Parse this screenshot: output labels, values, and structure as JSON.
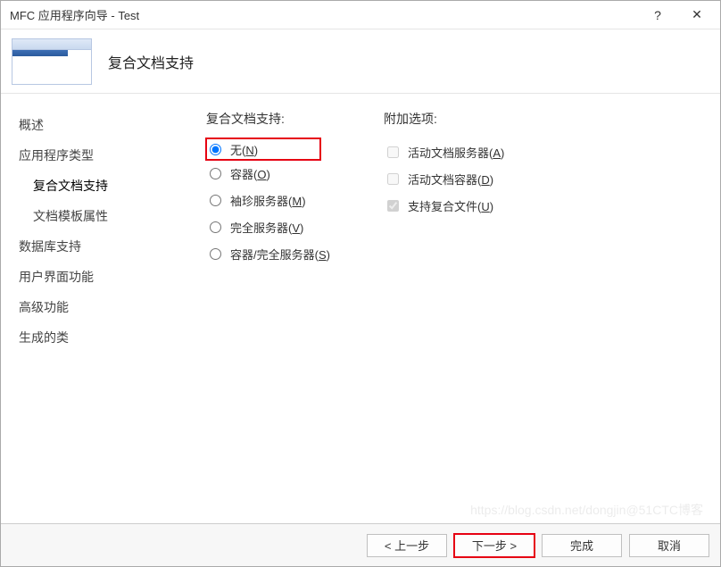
{
  "titlebar": {
    "title": "MFC 应用程序向导 - Test"
  },
  "header": {
    "heading": "复合文档支持"
  },
  "sidebar": {
    "items": [
      {
        "label": "概述",
        "sub": false
      },
      {
        "label": "应用程序类型",
        "sub": false
      },
      {
        "label": "复合文档支持",
        "sub": true,
        "active": true
      },
      {
        "label": "文档模板属性",
        "sub": true
      },
      {
        "label": "数据库支持",
        "sub": false
      },
      {
        "label": "用户界面功能",
        "sub": false
      },
      {
        "label": "高级功能",
        "sub": false
      },
      {
        "label": "生成的类",
        "sub": false
      }
    ]
  },
  "compound": {
    "label": "复合文档支持:",
    "options": {
      "none": {
        "text": "无",
        "accel": "N",
        "checked": true
      },
      "container": {
        "text": "容器",
        "accel": "O",
        "checked": false
      },
      "miniserver": {
        "text": "袖珍服务器",
        "accel": "M",
        "checked": false
      },
      "fullserver": {
        "text": "完全服务器",
        "accel": "V",
        "checked": false
      },
      "contserver": {
        "text": "容器/完全服务器",
        "accel": "S",
        "checked": false
      }
    }
  },
  "additional": {
    "label": "附加选项:",
    "options": {
      "activeserver": {
        "text": "活动文档服务器",
        "accel": "A",
        "checked": false
      },
      "activecontainer": {
        "text": "活动文档容器",
        "accel": "D",
        "checked": false
      },
      "compoundfile": {
        "text": "支持复合文件",
        "accel": "U",
        "checked": true
      }
    }
  },
  "footer": {
    "prev": "< 上一步",
    "next": "下一步 >",
    "finish": "完成",
    "cancel": "取消"
  },
  "watermark": "https://blog.csdn.net/dongjin@51CTC博客"
}
